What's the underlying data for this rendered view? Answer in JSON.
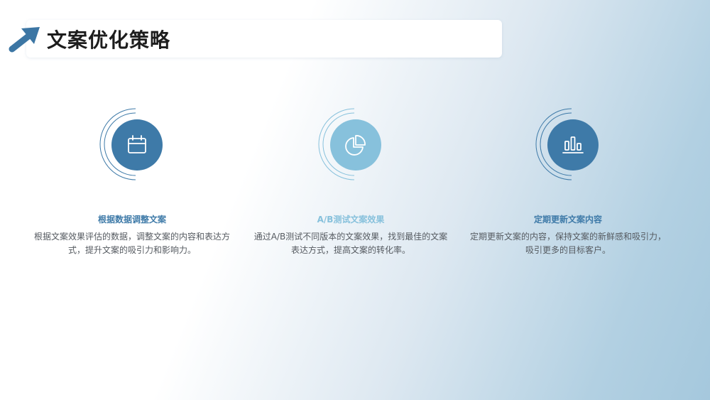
{
  "header": {
    "title": "文案优化策略",
    "icon": "arrow-up-right-icon",
    "accent_color": "#3c76a4"
  },
  "cards": [
    {
      "icon": "calendar-icon",
      "color": "#3e7aa8",
      "heading": "根据数据调整文案",
      "description": "根据文案效果评估的数据，调整文案的内容和表达方式，提升文案的吸引力和影响力。"
    },
    {
      "icon": "pie-chart-icon",
      "color": "#87c1dc",
      "heading": "A/B测试文案效果",
      "description": "通过A/B测试不同版本的文案效果，找到最佳的文案表达方式，提高文案的转化率。"
    },
    {
      "icon": "bar-chart-icon",
      "color": "#3e7aa8",
      "heading": "定期更新文案内容",
      "description": "定期更新文案的内容，保持文案的新鲜感和吸引力，吸引更多的目标客户。"
    }
  ]
}
